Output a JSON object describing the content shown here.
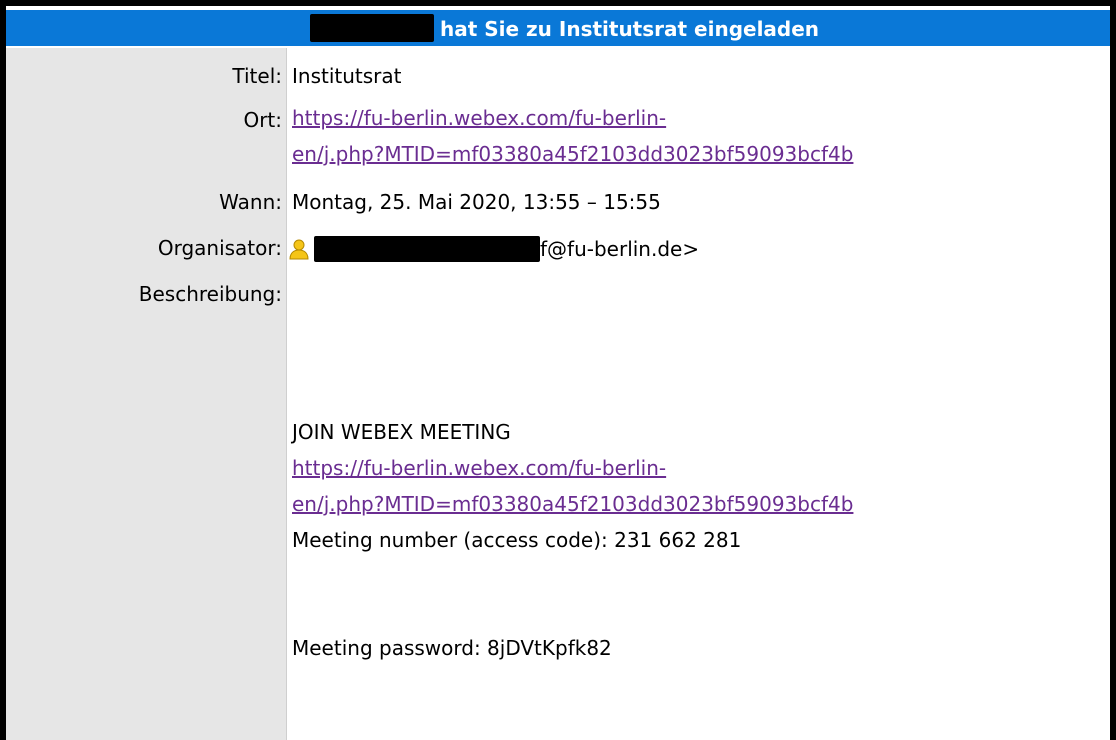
{
  "header": {
    "title": "hat Sie zu Institutsrat eingeladen"
  },
  "fields": {
    "titel": {
      "label": "Titel:",
      "value": "Institutsrat"
    },
    "ort": {
      "label": "Ort:",
      "link_line1": "https://fu-berlin.webex.com/fu-berlin-",
      "link_line2": "en/j.php?MTID=mf03380a45f2103dd3023bf59093bcf4b"
    },
    "wann": {
      "label": "Wann:",
      "value": "Montag, 25. Mai 2020, 13:55 – 15:55"
    },
    "organisator": {
      "label": "Organisator:",
      "email_suffix": "f@fu-berlin.de>",
      "icon": "person-icon"
    },
    "beschreibung": {
      "label": "Beschreibung:"
    }
  },
  "description": {
    "join_heading": "JOIN WEBEX MEETING",
    "link_line1": "https://fu-berlin.webex.com/fu-berlin-",
    "link_line2": "en/j.php?MTID=mf03380a45f2103dd3023bf59093bcf4b",
    "meeting_number": "Meeting number (access code): 231 662 281",
    "meeting_password": "Meeting password: 8jDVtKpfk82"
  },
  "colors": {
    "header_bg": "#0a78d7",
    "label_bg": "#e6e6e6",
    "link": "#6a2d91"
  }
}
